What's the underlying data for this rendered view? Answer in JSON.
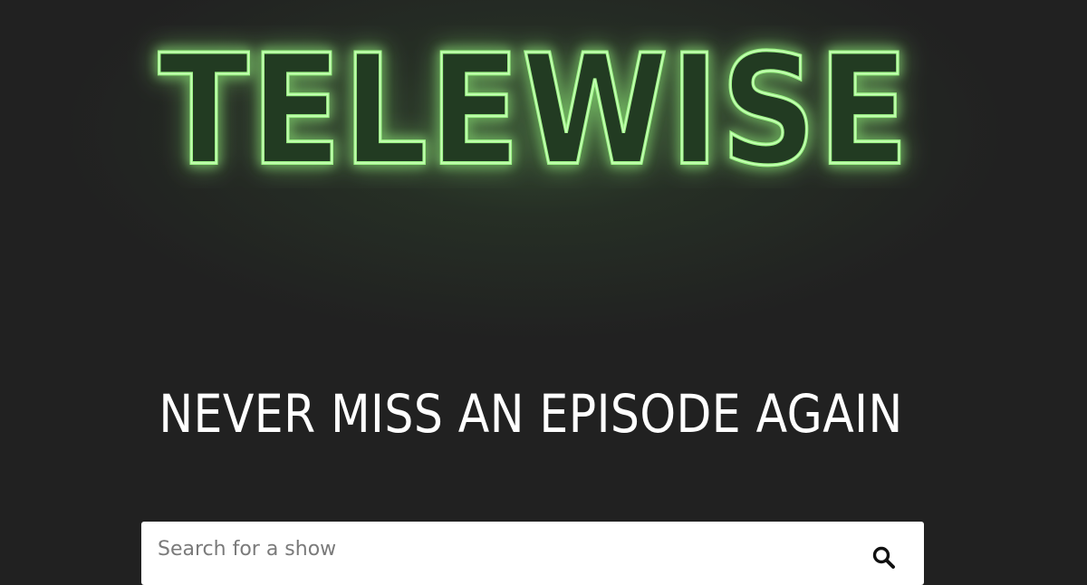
{
  "hero": {
    "logo_text": "TELEWISE",
    "tagline": "NEVER MISS AN EPISODE AGAIN"
  },
  "search": {
    "placeholder": "Search for a show",
    "value": "",
    "button_icon": "search-icon"
  },
  "colors": {
    "background": "#212121",
    "neon_green": "#8CF27A",
    "neon_glow": "#4CAF50",
    "tagline_text": "#ffffff",
    "search_bg": "#ffffff"
  }
}
